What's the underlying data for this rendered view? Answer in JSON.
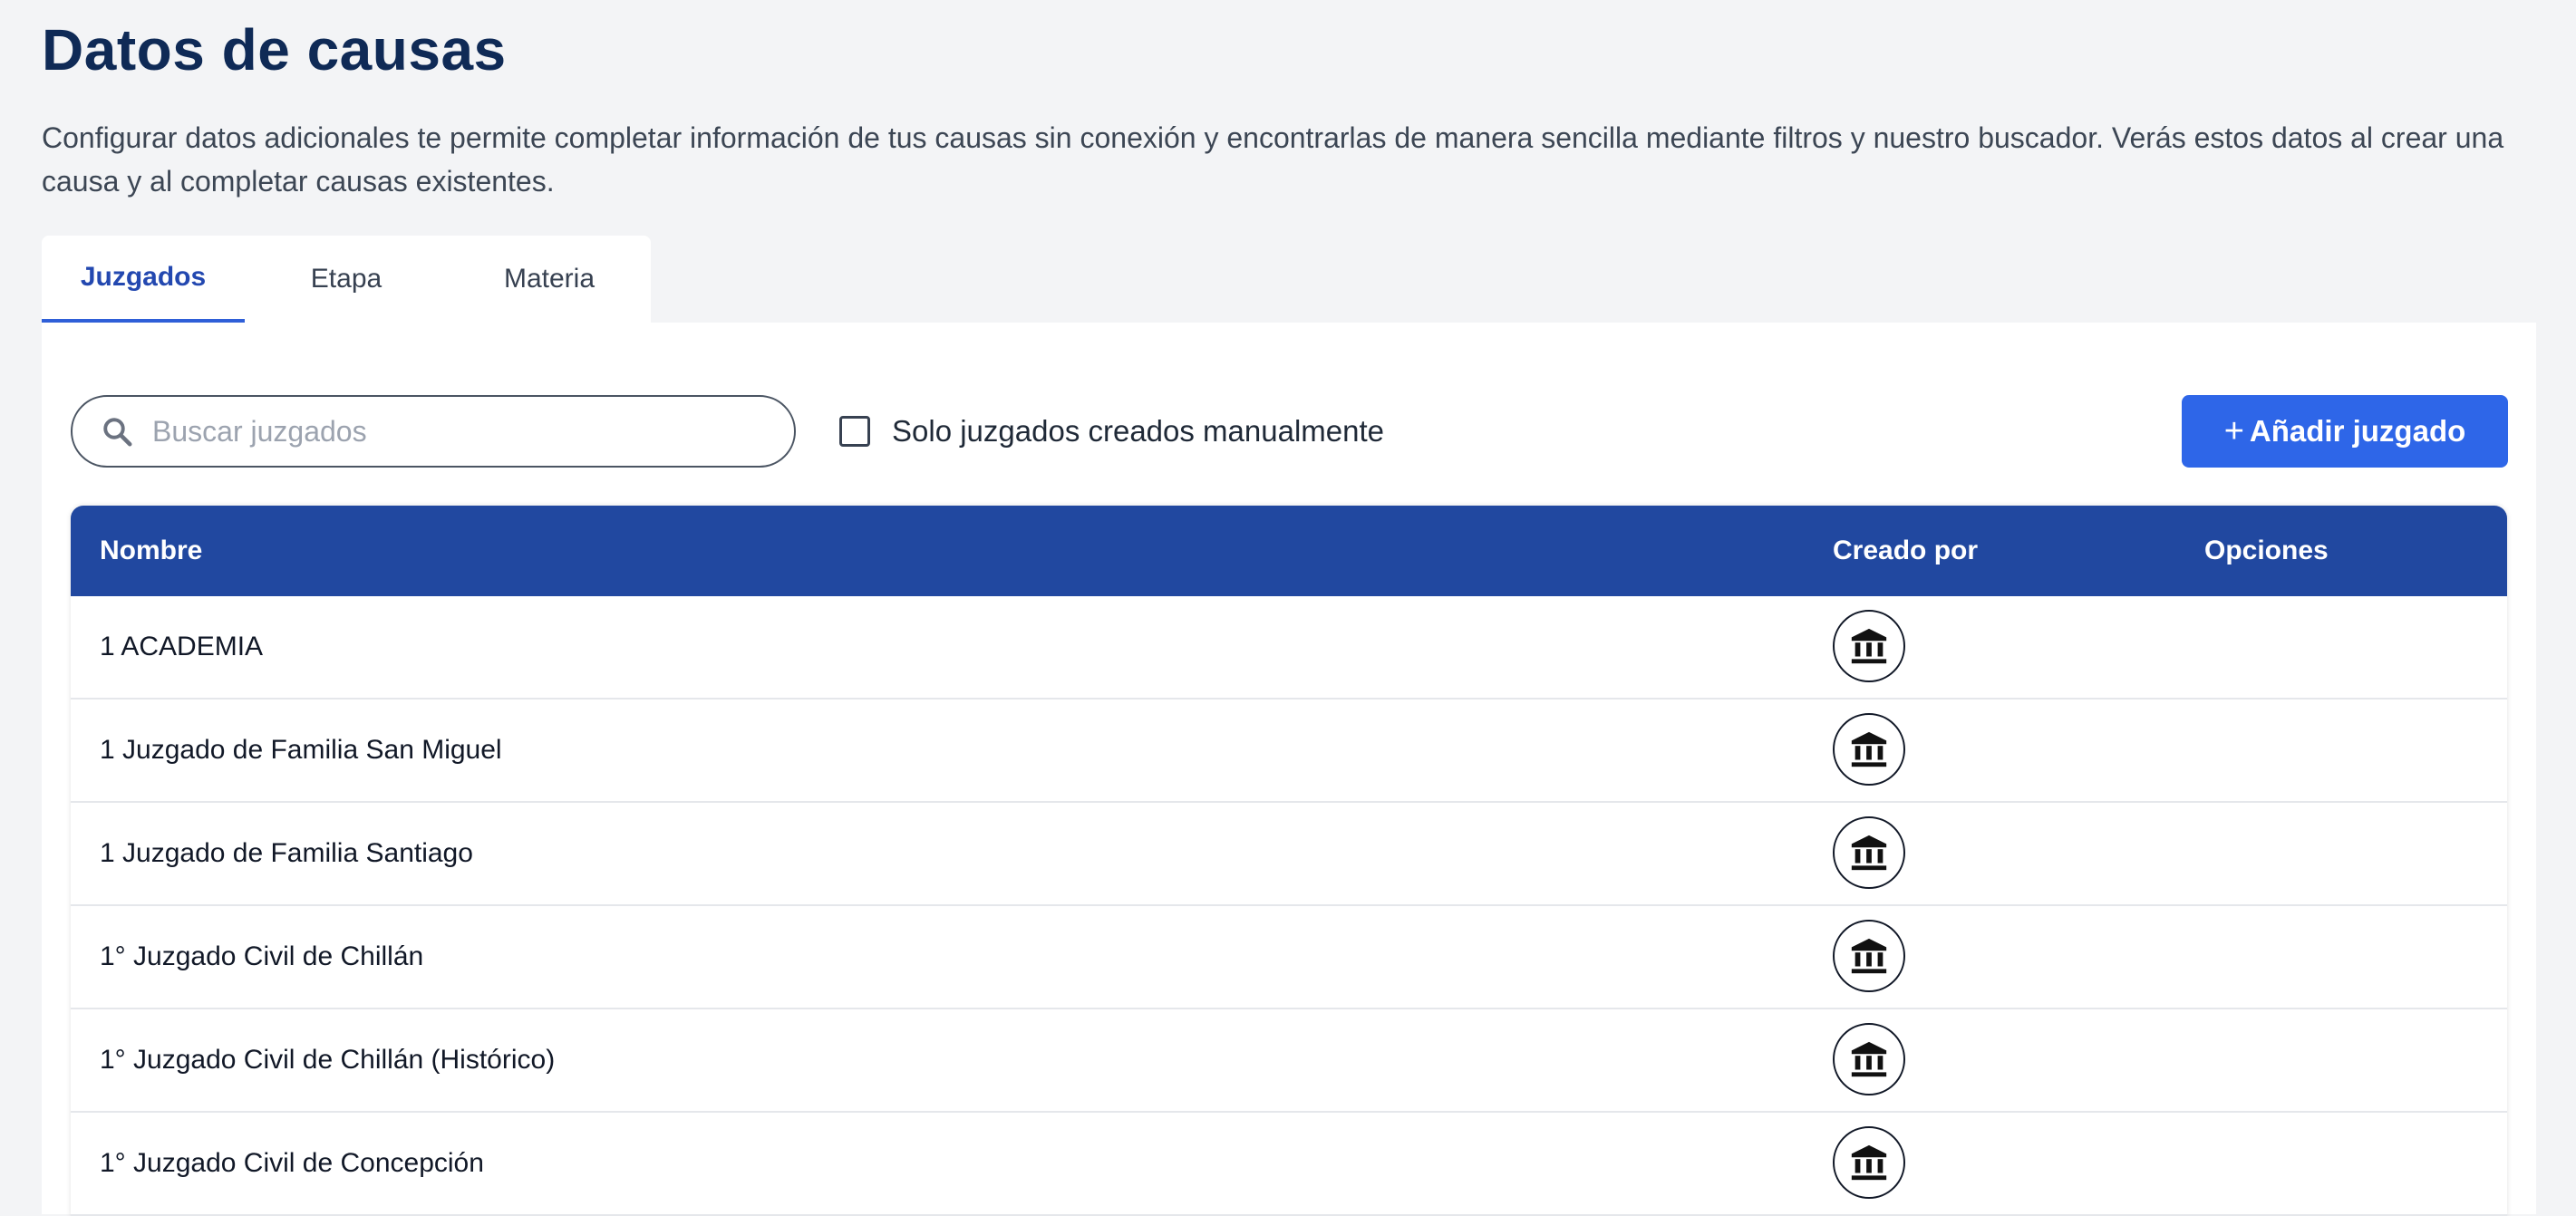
{
  "page": {
    "title": "Datos de causas",
    "description": "Configurar datos adicionales te permite completar información de tus causas sin conexión y encontrarlas de manera sencilla mediante filtros y nuestro buscador. Verás estos datos al crear una causa y al completar causas existentes."
  },
  "tabs": [
    {
      "label": "Juzgados",
      "active": true
    },
    {
      "label": "Etapa",
      "active": false
    },
    {
      "label": "Materia",
      "active": false
    }
  ],
  "toolbar": {
    "search_placeholder": "Buscar juzgados",
    "search_value": "",
    "search_icon": "search-icon",
    "checkbox_label": "Solo juzgados creados manualmente",
    "checkbox_checked": false,
    "add_button_plus": "+",
    "add_button_label": "Añadir juzgado"
  },
  "table": {
    "columns": {
      "name": "Nombre",
      "creator": "Creado por",
      "options": "Opciones"
    },
    "rows": [
      {
        "name": "1 ACADEMIA",
        "creator_icon": "courthouse-icon"
      },
      {
        "name": "1 Juzgado de Familia San Miguel",
        "creator_icon": "courthouse-icon"
      },
      {
        "name": "1 Juzgado de Familia Santiago",
        "creator_icon": "courthouse-icon"
      },
      {
        "name": "1° Juzgado Civil de Chillán",
        "creator_icon": "courthouse-icon"
      },
      {
        "name": "1° Juzgado Civil de Chillán (Histórico)",
        "creator_icon": "courthouse-icon"
      },
      {
        "name": "1° Juzgado Civil de Concepción",
        "creator_icon": "courthouse-icon"
      }
    ]
  },
  "colors": {
    "title": "#0f2a56",
    "accent": "#2e66e8",
    "table_header": "#2148a0",
    "active_tab": "#2348b0"
  }
}
